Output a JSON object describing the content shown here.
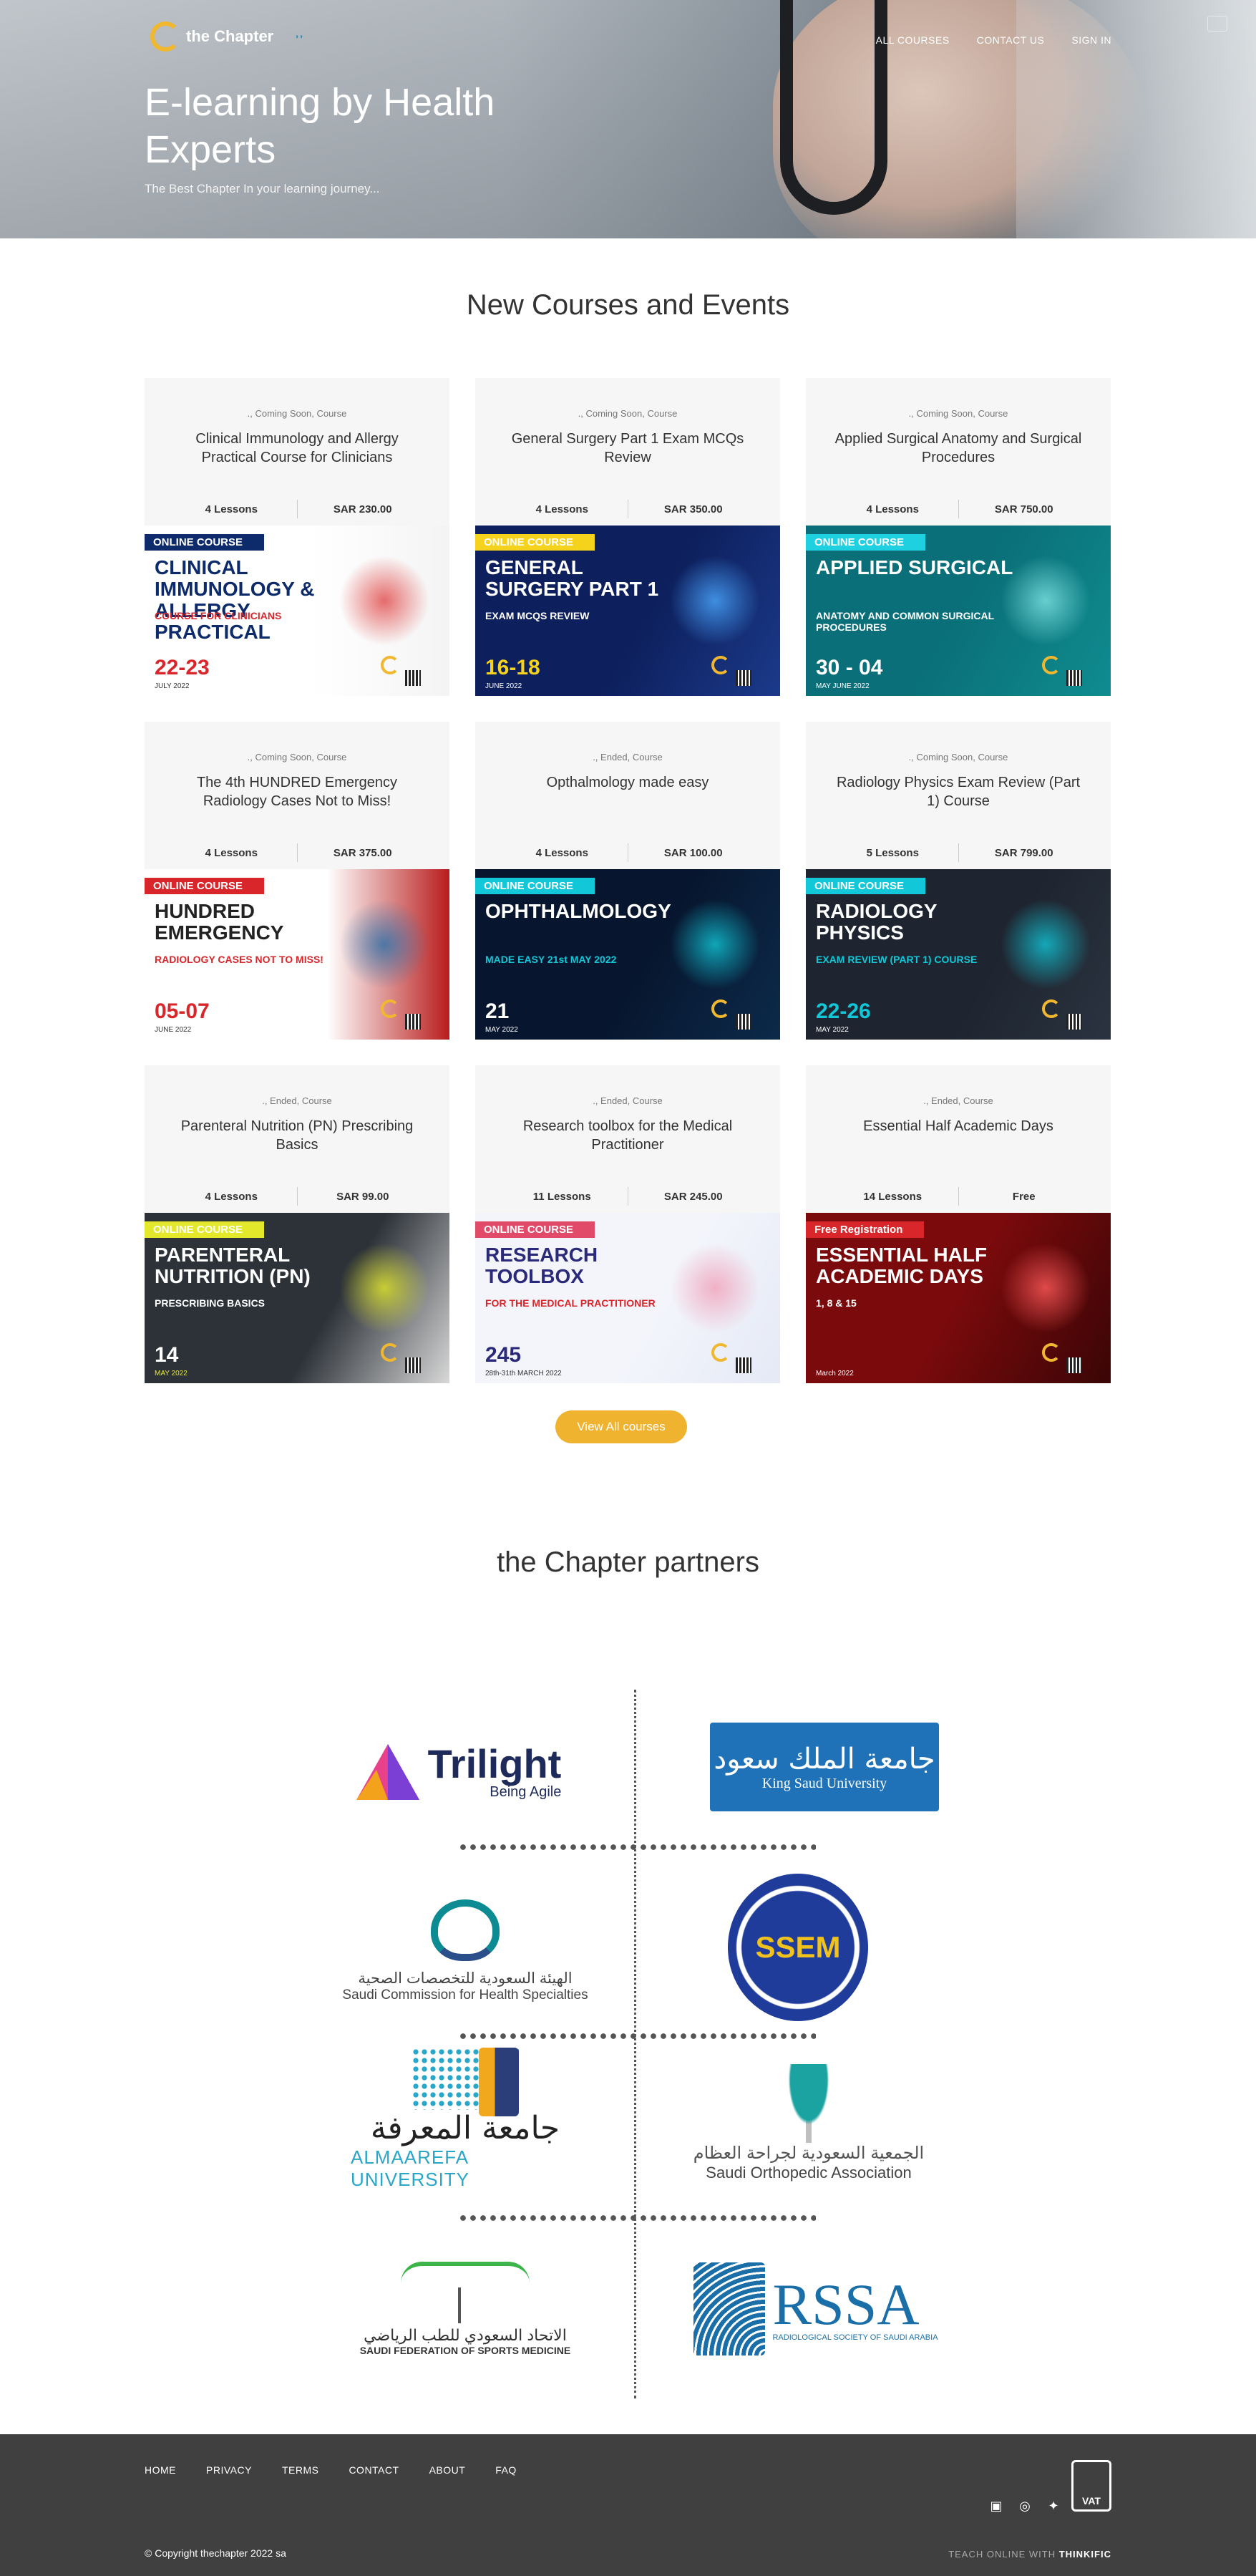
{
  "header": {
    "logo_text": "the Chapter",
    "nav": [
      "ALL COURSES",
      "CONTACT US",
      "SIGN IN"
    ],
    "hero_title": "E-learning by Health Experts",
    "hero_subtitle": "The Best Chapter In your learning journey..."
  },
  "courses_section": {
    "title": "New Courses and Events",
    "view_all_label": "View All courses",
    "cards": [
      {
        "meta": "., Coming Soon, Course",
        "title": "Clinical Immunology and Allergy Practical Course for Clinicians",
        "lessons": "4 Lessons",
        "price": "SAR 230.00",
        "banner": {
          "tag": "ONLINE COURSE",
          "headline": "CLINICAL IMMUNOLOGY & ALLERGY PRACTICAL",
          "subline": "COURSE FOR CLINICIANS",
          "date": "22-23",
          "extra": "JULY 2022"
        }
      },
      {
        "meta": "., Coming Soon, Course",
        "title": "General Surgery Part 1 Exam MCQs Review",
        "lessons": "4 Lessons",
        "price": "SAR 350.00",
        "banner": {
          "tag": "ONLINE COURSE",
          "headline": "GENERAL SURGERY PART 1",
          "subline": "EXAM MCQS REVIEW",
          "date": "16-18",
          "extra": "JUNE 2022"
        }
      },
      {
        "meta": "., Coming Soon, Course",
        "title": "Applied Surgical Anatomy and Surgical Procedures",
        "lessons": "4 Lessons",
        "price": "SAR 750.00",
        "banner": {
          "tag": "ONLINE COURSE",
          "headline": "APPLIED SURGICAL",
          "subline": "ANATOMY AND COMMON SURGICAL PROCEDURES",
          "date": "30 - 04",
          "extra": "MAY  JUNE 2022"
        }
      },
      {
        "meta": "., Coming Soon, Course",
        "title": "The 4th HUNDRED Emergency Radiology Cases Not to Miss!",
        "lessons": "4 Lessons",
        "price": "SAR 375.00",
        "banner": {
          "tag": "ONLINE COURSE",
          "headline": "HUNDRED EMERGENCY",
          "subline": "RADIOLOGY CASES NOT TO MISS!",
          "date": "05-07",
          "extra": "JUNE 2022"
        }
      },
      {
        "meta": "., Ended, Course",
        "title": "Opthalmology made easy",
        "lessons": "4 Lessons",
        "price": "SAR 100.00",
        "banner": {
          "tag": "ONLINE COURSE",
          "headline": "OPHTHALMOLOGY",
          "subline": "MADE EASY 21st MAY 2022",
          "date": "21",
          "extra": "MAY 2022"
        }
      },
      {
        "meta": "., Coming Soon, Course",
        "title": "Radiology Physics Exam Review (Part 1) Course",
        "lessons": "5 Lessons",
        "price": "SAR 799.00",
        "banner": {
          "tag": "ONLINE COURSE",
          "headline": "RADIOLOGY PHYSICS",
          "subline": "EXAM REVIEW (PART 1) COURSE",
          "date": "22-26",
          "extra": "MAY 2022"
        }
      },
      {
        "meta": "., Ended, Course",
        "title": "Parenteral Nutrition (PN) Prescribing Basics",
        "lessons": "4 Lessons",
        "price": "SAR 99.00",
        "banner": {
          "tag": "ONLINE COURSE",
          "headline": "PARENTERAL NUTRITION (PN)",
          "subline": "PRESCRIBING BASICS",
          "date": "14",
          "extra": "MAY 2022"
        }
      },
      {
        "meta": "., Ended, Course",
        "title": "Research toolbox for the Medical Practitioner",
        "lessons": "11 Lessons",
        "price": "SAR 245.00",
        "banner": {
          "tag": "ONLINE COURSE",
          "headline": "RESEARCH TOOLBOX",
          "subline": "FOR THE MEDICAL PRACTITIONER",
          "date": "245",
          "extra": "28th-31th MARCH 2022"
        }
      },
      {
        "meta": "., Ended, Course",
        "title": "Essential Half Academic Days",
        "lessons": "14 Lessons",
        "price": "Free",
        "banner": {
          "tag": "Free Registration",
          "headline": "ESSENTIAL HALF ACADEMIC DAYS",
          "subline": "1, 8 & 15",
          "date": "",
          "extra": "March 2022"
        }
      }
    ]
  },
  "partners_section": {
    "title": "the Chapter partners",
    "partners": [
      {
        "name": "Trilight",
        "tagline": "Being Agile"
      },
      {
        "name": "King Saud University",
        "tagline": "جامعة الملك سعود"
      },
      {
        "name": "Saudi Commission for Health Specialties",
        "tagline": "الهيئة السعودية للتخصصات الصحية"
      },
      {
        "name": "SSEM",
        "tagline": ""
      },
      {
        "name": "ALMAAREFA UNIVERSITY",
        "tagline": "جامعة المعرفة"
      },
      {
        "name": "Saudi Orthopedic Association",
        "tagline": "الجمعية السعودية لجراحة العظام"
      },
      {
        "name": "SAUDI FEDERATION OF SPORTS MEDICINE",
        "tagline": "الاتحاد السعودي للطب الرياضي"
      },
      {
        "name": "RSSA",
        "tagline": "RADIOLOGICAL SOCIETY OF SAUDI ARABIA"
      }
    ]
  },
  "footer": {
    "links": [
      "HOME",
      "PRIVACY",
      "TERMS",
      "CONTACT",
      "ABOUT",
      "FAQ"
    ],
    "copyright": "© Copyright thechapter 2022 sa",
    "teach_prefix": "TEACH ONLINE WITH",
    "teach_brand": "THINKIFIC",
    "vat_label": "VAT",
    "social_icons": [
      "facebook-icon",
      "instagram-icon",
      "twitter-icon"
    ]
  }
}
